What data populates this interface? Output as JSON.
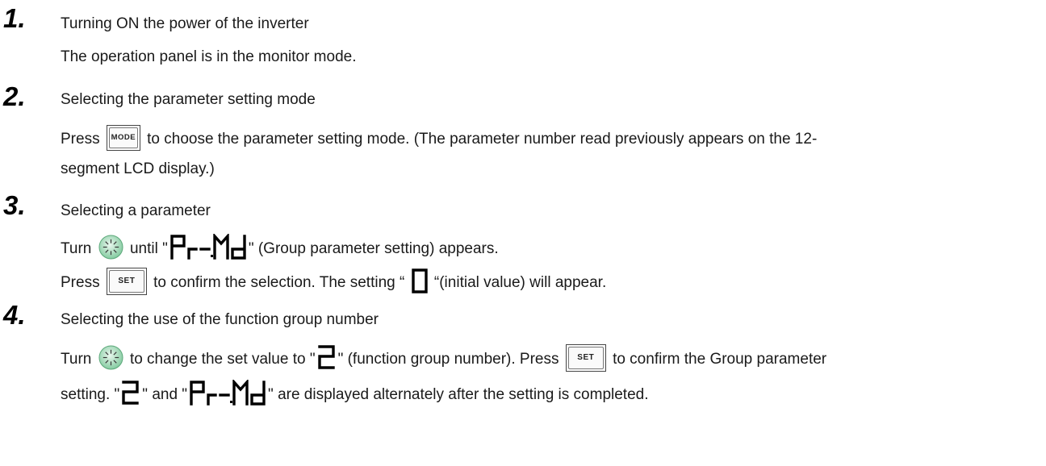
{
  "steps": [
    {
      "number": "1.",
      "title": "Turning ON the power of the inverter",
      "line": "The operation panel is in the monitor mode."
    },
    {
      "number": "2.",
      "title": "Selecting the parameter setting mode",
      "press": "Press",
      "text_a": "to choose the parameter setting mode. (The parameter number read previously appears on the 12-",
      "text_b": "segment LCD display.)"
    },
    {
      "number": "3.",
      "title": "Selecting a parameter",
      "turn": "Turn",
      "until": "until \"",
      "group_note": "\" (Group parameter setting) appears.",
      "press": "Press",
      "confirm": "to confirm the selection. The setting “",
      "initial": "“(initial value) will appear."
    },
    {
      "number": "4.",
      "title": "Selecting the use of the function group number",
      "turn": "Turn",
      "change": "to change the set value to \"",
      "fgn": "\" (function group number). Press",
      "confirm_group": "to confirm the Group parameter",
      "setting_open": "setting. \"",
      "and": "\" and \"",
      "alternate": "\" are displayed alternately after the setting is completed."
    }
  ],
  "buttons": {
    "mode": "MODE",
    "set": "SET"
  },
  "lcd": {
    "prmd": "P.r.-.M.d",
    "zero": "0",
    "two": "2"
  },
  "icons": {
    "dial": "setting-dial-icon",
    "dial_color": "#8fd0a8"
  }
}
